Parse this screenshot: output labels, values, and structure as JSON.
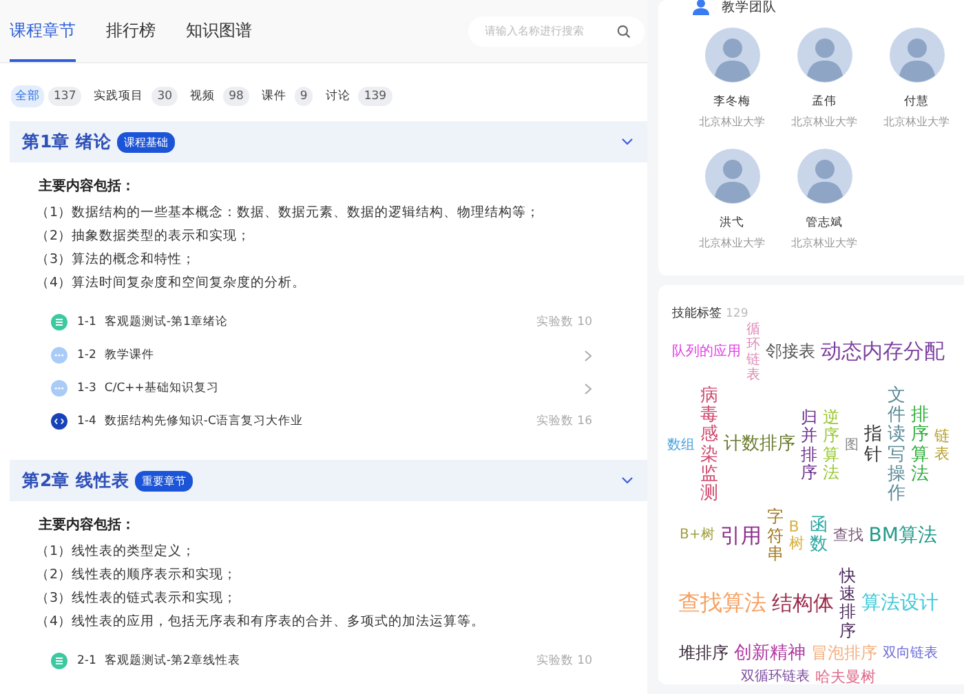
{
  "tabs": [
    {
      "label": "课程章节",
      "selected": true
    },
    {
      "label": "排行榜",
      "selected": false
    },
    {
      "label": "知识图谱",
      "selected": false
    }
  ],
  "search": {
    "placeholder": "请输入名称进行搜索"
  },
  "filters": [
    {
      "label": "全部",
      "count": "137",
      "selected": true
    },
    {
      "label": "实践项目",
      "count": "30",
      "selected": false
    },
    {
      "label": "视频",
      "count": "98",
      "selected": false
    },
    {
      "label": "课件",
      "count": "9",
      "selected": false
    },
    {
      "label": "讨论",
      "count": "139",
      "selected": false
    }
  ],
  "chapters": [
    {
      "title": "第1章 绪论",
      "badge": "课程基础",
      "expanded": true,
      "summary_title": "主要内容包括：",
      "points": [
        "（1）数据结构的一些基本概念：数据、数据元素、数据的逻辑结构、物理结构等；",
        "（2）抽象数据类型的表示和实现；",
        "（3）算法的概念和特性；",
        "（4）算法时间复杂度和空间复杂度的分析。"
      ],
      "items": [
        {
          "kind": "quiz",
          "number": "1-1",
          "title": "客观题测试-第1章绪论",
          "meta": "实验数 10"
        },
        {
          "kind": "courseware",
          "number": "1-2",
          "title": "教学课件"
        },
        {
          "kind": "courseware",
          "number": "1-3",
          "title": "C/C++基础知识复习"
        },
        {
          "kind": "code",
          "number": "1-4",
          "title": "数据结构先修知识-C语言复习大作业",
          "meta": "实验数 16"
        }
      ]
    },
    {
      "title": "第2章 线性表",
      "badge": "重要章节",
      "expanded": true,
      "summary_title": "主要内容包括：",
      "points": [
        "（1）线性表的类型定义；",
        "（2）线性表的顺序表示和实现；",
        "（3）线性表的链式表示和实现；",
        "（4）线性表的应用，包括无序表和有序表的合并、多项式的加法运算等。"
      ],
      "items": [
        {
          "kind": "quiz",
          "number": "2-1",
          "title": "客观题测试-第2章线性表",
          "meta": "实验数 10"
        }
      ]
    }
  ],
  "team": {
    "title": "教学团队",
    "members": [
      {
        "name": "李冬梅",
        "school": "北京林业大学"
      },
      {
        "name": "孟伟",
        "school": "北京林业大学"
      },
      {
        "name": "付慧",
        "school": "北京林业大学"
      },
      {
        "name": "洪弋",
        "school": "北京林业大学"
      },
      {
        "name": "管志斌",
        "school": "北京林业大学"
      }
    ]
  },
  "skills": {
    "title": "技能标签",
    "count": "129",
    "tags": [
      {
        "text": "队列的应用",
        "color": "#e23ee6",
        "vertical": false
      },
      {
        "text": "循环链表",
        "color": "#e08ab8",
        "vertical": true
      },
      {
        "text": "邻接表",
        "color": "#555555",
        "vertical": false
      },
      {
        "text": "动态内存分配",
        "color": "#7b3f9e",
        "vertical": false
      },
      {
        "text": "数组",
        "color": "#4aa3df",
        "vertical": false
      },
      {
        "text": "病毒感染监测",
        "color": "#d0486e",
        "vertical": true
      },
      {
        "text": "计数排序",
        "color": "#6b7a2e",
        "vertical": false
      },
      {
        "text": "归并排序",
        "color": "#6a2c8c",
        "vertical": true
      },
      {
        "text": "逆序算法",
        "color": "#98c830",
        "vertical": true
      },
      {
        "text": "图",
        "color": "#888888",
        "vertical": false
      },
      {
        "text": "指针",
        "color": "#333333",
        "vertical": true
      },
      {
        "text": "文件读写操作",
        "color": "#5a8a96",
        "vertical": true
      },
      {
        "text": "排序算法",
        "color": "#2fae3a",
        "vertical": true
      },
      {
        "text": "链表",
        "color": "#b7a030",
        "vertical": true
      },
      {
        "text": "B+树",
        "color": "#a0a040",
        "vertical": false
      },
      {
        "text": "引用",
        "color": "#8a2a8a",
        "vertical": false
      },
      {
        "text": "字符串",
        "color": "#a0761c",
        "vertical": true
      },
      {
        "text": "B树",
        "color": "#d8b040",
        "vertical": true
      },
      {
        "text": "函数",
        "color": "#2aa6a0",
        "vertical": true
      },
      {
        "text": "查找",
        "color": "#7a5a7a",
        "vertical": false
      },
      {
        "text": "BM算法",
        "color": "#239a8a",
        "vertical": false
      },
      {
        "text": "查找算法",
        "color": "#f6a060",
        "vertical": false
      },
      {
        "text": "结构体",
        "color": "#9a2a4a",
        "vertical": false
      },
      {
        "text": "快速排序",
        "color": "#4a2a5a",
        "vertical": true
      },
      {
        "text": "算法设计",
        "color": "#3ec8d8",
        "vertical": false
      },
      {
        "text": "堆排序",
        "color": "#3a2a3a",
        "vertical": false
      },
      {
        "text": "创新精神",
        "color": "#b03aa0",
        "vertical": false
      },
      {
        "text": "冒泡排序",
        "color": "#f4b080",
        "vertical": false
      },
      {
        "text": "双向链表",
        "color": "#6a6ad8",
        "vertical": false
      },
      {
        "text": "双循环链表",
        "color": "#7a4aa0",
        "vertical": false
      },
      {
        "text": "哈夫曼树",
        "color": "#e06a8a",
        "vertical": false
      }
    ]
  }
}
